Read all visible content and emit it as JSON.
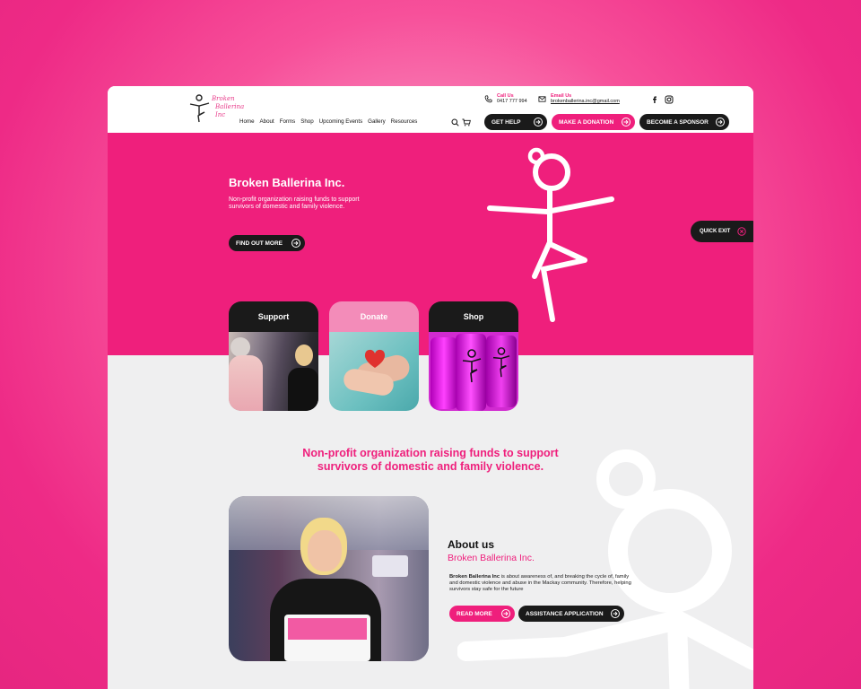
{
  "brand": {
    "logo_text": [
      "Broken",
      "Ballerina",
      "Inc"
    ],
    "accent": "#ef1f7c",
    "dark": "#1a1a1a"
  },
  "header": {
    "nav": [
      "Home",
      "About",
      "Forms",
      "Shop",
      "Upcoming Events",
      "Gallery",
      "Resources"
    ],
    "call_label": "Call Us",
    "call_value": "0417 777 994",
    "email_label": "Email Us",
    "email_value": "brokenballerina.inc@gmail.com",
    "get_help": "GET HELP",
    "donate": "MAKE A DONATION",
    "sponsor": "BECOME A SPONSOR"
  },
  "hero": {
    "title": "Broken Ballerina Inc.",
    "subtitle": "Non-profit organization raising funds to support survivors of domestic and family violence.",
    "cta": "FIND OUT MORE",
    "quick_exit": "QUICK EXIT"
  },
  "tiles": [
    {
      "label": "Support"
    },
    {
      "label": "Donate"
    },
    {
      "label": "Shop"
    }
  ],
  "tagline": {
    "line1": "Non-profit organization raising funds to support",
    "line2": "survivors of domestic and family violence."
  },
  "about": {
    "title": "About us",
    "subtitle": "Broken Ballerina Inc.",
    "body_bold": "Broken Ballerina Inc",
    "body_rest": " is about awareness of, and breaking the cycle of, family and domestic violence and abuse in the Mackay community. Therefore, helping survivors stay safe for the future",
    "read_more": "READ MORE",
    "assistance": "ASSISTANCE APPLICATION"
  }
}
